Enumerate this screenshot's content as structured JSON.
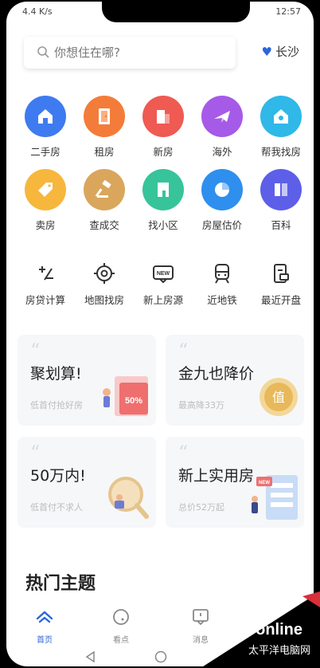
{
  "status": {
    "left": "4.4 K/s",
    "time": "12:57"
  },
  "search": {
    "placeholder": "你想住在哪?",
    "city": "长沙"
  },
  "services": [
    {
      "label": "二手房",
      "icon": "house-icon",
      "color": "#3f7bf0"
    },
    {
      "label": "租房",
      "icon": "door-icon",
      "color": "#f47c3a"
    },
    {
      "label": "新房",
      "icon": "building-icon",
      "color": "#ef5a52"
    },
    {
      "label": "海外",
      "icon": "plane-icon",
      "color": "#a65ae8"
    },
    {
      "label": "帮我找房",
      "icon": "find-home-icon",
      "color": "#2fb8e8"
    },
    {
      "label": "卖房",
      "icon": "tag-icon",
      "color": "#f6b73c"
    },
    {
      "label": "查成交",
      "icon": "gavel-icon",
      "color": "#d9a65c"
    },
    {
      "label": "找小区",
      "icon": "community-icon",
      "color": "#37c49a"
    },
    {
      "label": "房屋估价",
      "icon": "pie-chart-icon",
      "color": "#2f8fee"
    },
    {
      "label": "百科",
      "icon": "book-icon",
      "color": "#5d5fe8"
    }
  ],
  "tools": [
    {
      "label": "房贷计算",
      "icon": "calculator-icon"
    },
    {
      "label": "地图找房",
      "icon": "map-target-icon"
    },
    {
      "label": "新上房源",
      "icon": "new-badge-icon",
      "badge": "NEW"
    },
    {
      "label": "近地铁",
      "icon": "subway-icon"
    },
    {
      "label": "最近开盘",
      "icon": "document-icon"
    }
  ],
  "cards": [
    {
      "title": "聚划算!",
      "sub": "低首付抢好房",
      "art": "discount-tickets-icon",
      "art_text": "50%"
    },
    {
      "title": "金九也降价",
      "sub": "最高降33万",
      "art": "coin-icon",
      "art_text": "值"
    },
    {
      "title": "50万内!",
      "sub": "低首付不求人",
      "art": "magnifier-icon",
      "art_text": ""
    },
    {
      "title": "新上实用房",
      "sub": "总价52万起",
      "art": "new-house-icon",
      "art_text": "NEW"
    }
  ],
  "section": {
    "title": "热门主题"
  },
  "tabs": [
    {
      "label": "首页",
      "icon": "home-tab-icon",
      "active": true
    },
    {
      "label": "看点",
      "icon": "discover-tab-icon",
      "active": false
    },
    {
      "label": "消息",
      "icon": "message-tab-icon",
      "active": false
    }
  ],
  "watermark": {
    "brand": "PConline",
    "sub": "太平洋电脑网"
  },
  "colors": {
    "accent": "#2b66d9"
  }
}
